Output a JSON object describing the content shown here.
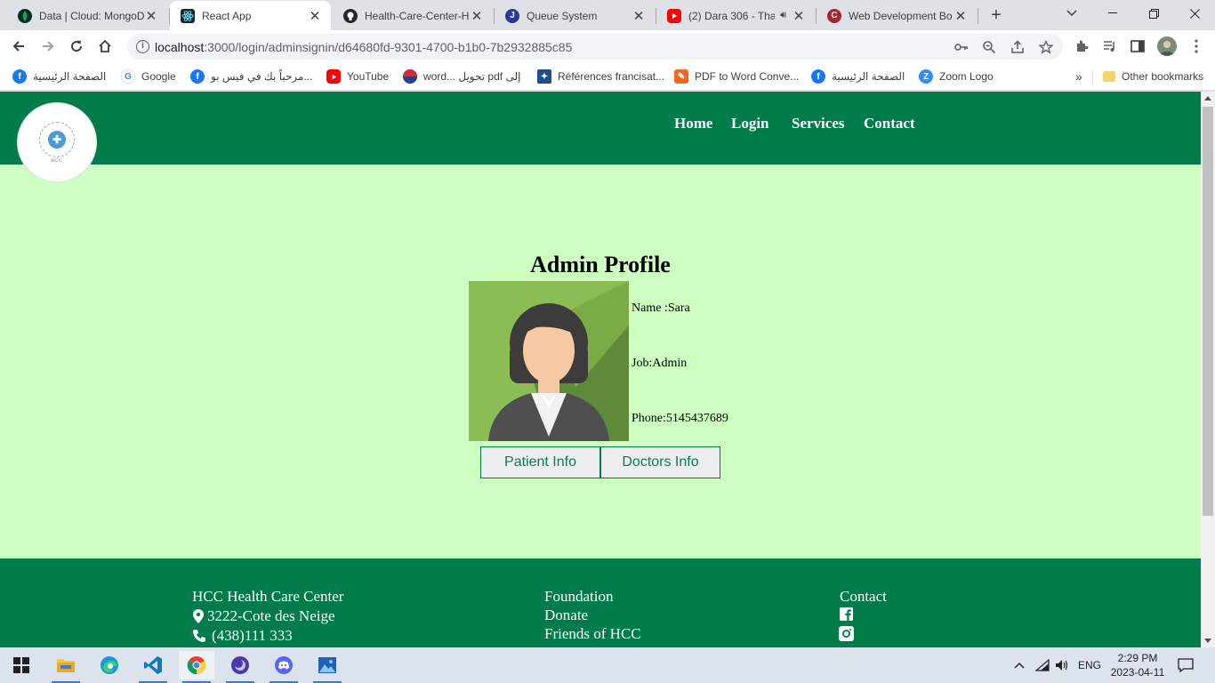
{
  "browser": {
    "tabs": [
      {
        "title": "Data | Cloud: MongoDB",
        "favicon": "mongodb-leaf-icon",
        "active": false
      },
      {
        "title": "React App",
        "favicon": "react-icon",
        "active": true
      },
      {
        "title": "Health-Care-Center-H",
        "favicon": "github-icon",
        "active": false
      },
      {
        "title": "Queue System",
        "favicon": "j-letter-icon",
        "active": false
      },
      {
        "title": "(2) Dara 306 - Tha",
        "favicon": "youtube-icon",
        "active": false
      },
      {
        "title": "Web Development Bo",
        "favicon": "c-letter-icon",
        "active": false
      }
    ],
    "address": {
      "host": "localhost",
      "path": ":3000/login/adminsignin/d64680fd-9301-4700-b1b0-7b2932885c85"
    },
    "bookmarks": [
      {
        "label": "الصفحة الرئيسية",
        "icon": "facebook-icon"
      },
      {
        "label": "Google",
        "icon": "google-icon"
      },
      {
        "label": "مرحباً بك في فيس بو...",
        "icon": "facebook-icon"
      },
      {
        "label": "YouTube",
        "icon": "youtube-icon"
      },
      {
        "label": "word... تحويل pdf إلى",
        "icon": "converter-icon"
      },
      {
        "label": "Références francisat...",
        "icon": "reference-icon"
      },
      {
        "label": "PDF to Word Conve...",
        "icon": "pdf-icon"
      },
      {
        "label": "الصفحة الرئيسية",
        "icon": "facebook-icon"
      },
      {
        "label": "Zoom Logo",
        "icon": "zoom-icon"
      }
    ],
    "more_bookmarks": "»",
    "other_bookmarks": "Other bookmarks"
  },
  "site": {
    "logo_text": "HCC",
    "nav": [
      "Home",
      "Login",
      "Services",
      "Contact"
    ],
    "profile": {
      "title": "Admin Profile",
      "name_line": "Name :Sara",
      "job_line": "Job:Admin",
      "phone_line": "Phone:5145437689"
    },
    "buttons": {
      "patient": "Patient Info",
      "doctors": "Doctors Info"
    },
    "footer": {
      "col1": {
        "title": "HCC Health Care Center",
        "address": "3222-Cote des Neige",
        "phone": "(438)111 333"
      },
      "col2": [
        "Foundation",
        "Donate",
        "Friends of HCC"
      ],
      "col3": {
        "title": "Contact"
      }
    }
  },
  "taskbar": {
    "language": "ENG",
    "time": "2:29 PM",
    "date": "2023-04-11"
  },
  "colors": {
    "header_green": "#007b4a",
    "page_bg": "#ccffc0",
    "button_text": "#0a7a55"
  }
}
